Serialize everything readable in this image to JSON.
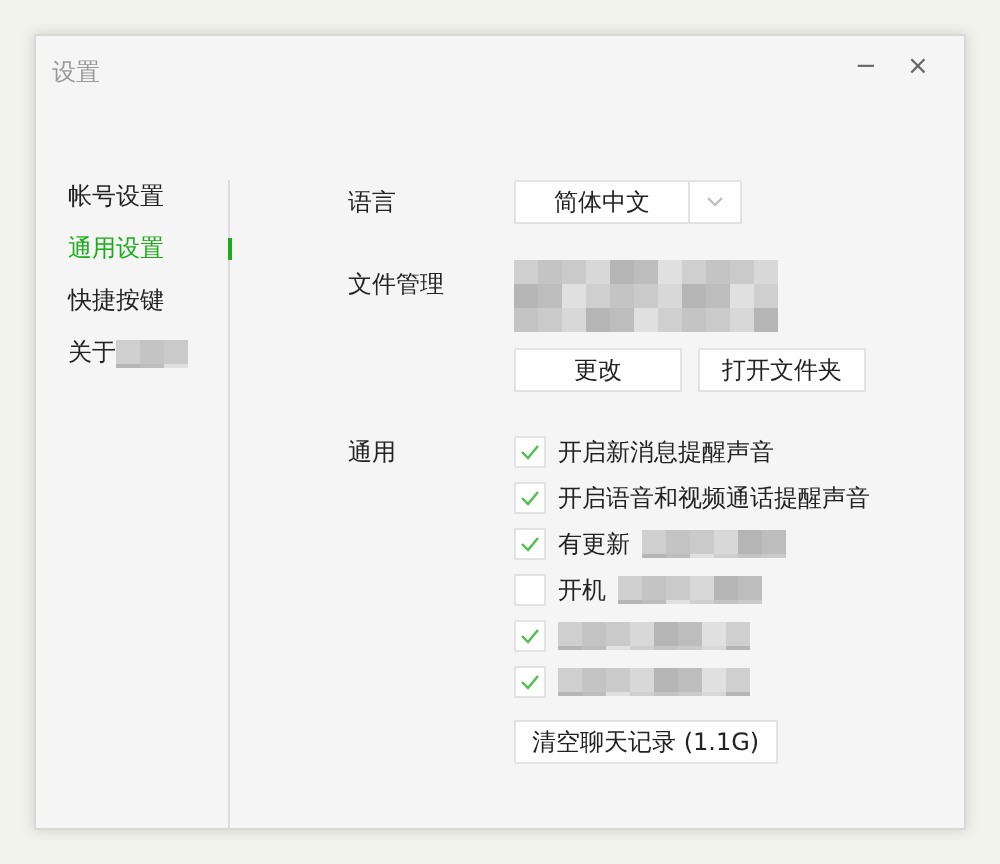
{
  "window": {
    "title": "设置",
    "controls": [
      "−",
      "×"
    ]
  },
  "sidebar": {
    "items": [
      {
        "label": "帐号设置",
        "selected": false,
        "redacted": false
      },
      {
        "label": "通用设置",
        "selected": true,
        "redacted": false
      },
      {
        "label": "快捷按键",
        "selected": false,
        "redacted": false
      },
      {
        "label": "关于",
        "selected": false,
        "redacted": true
      }
    ]
  },
  "language": {
    "label": "语言",
    "value": "简体中文"
  },
  "files": {
    "label": "文件管理",
    "redacted": true,
    "buttons": [
      "更改",
      "打开文件夹"
    ]
  },
  "general": {
    "label": "通用",
    "options": [
      {
        "label": "开启新消息提醒声音",
        "checked": true,
        "redacted": false
      },
      {
        "label": "开启语音和视频通话提醒声音",
        "checked": true,
        "redacted": false
      },
      {
        "label": "有更新",
        "checked": true,
        "redacted": true
      },
      {
        "label": "开机",
        "checked": false,
        "redacted": true
      },
      {
        "checked": true,
        "redacted": true
      },
      {
        "checked": true,
        "redacted": true
      }
    ],
    "clear_button": "清空聊天记录 (1.1G)"
  }
}
